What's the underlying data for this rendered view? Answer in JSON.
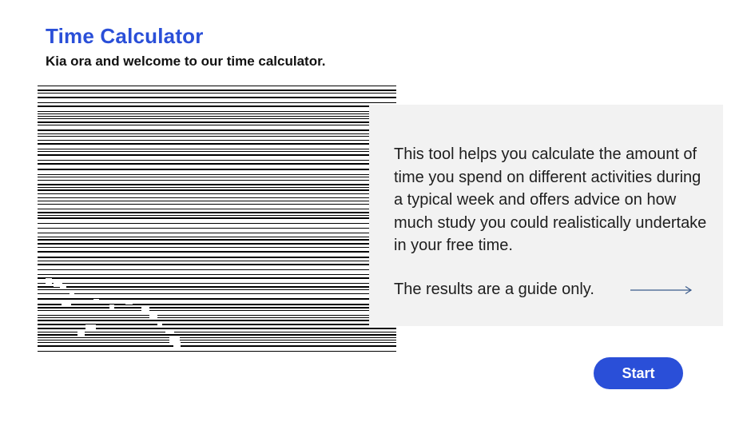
{
  "header": {
    "title": "Time Calculator",
    "subtitle": "Kia ora and welcome to our time calculator."
  },
  "info_card": {
    "description": "This tool helps you calculate the amount of time you spend on different activities during a typical week and offers advice on how much study you could realistically undertake in your free time.",
    "disclaimer": "The results are a guide only.",
    "arrow_icon": "arrow-right-icon"
  },
  "actions": {
    "start_label": "Start"
  },
  "colors": {
    "accent": "#2a4fd8",
    "card_background": "#f2f2f2",
    "text": "#1e1e1e"
  }
}
